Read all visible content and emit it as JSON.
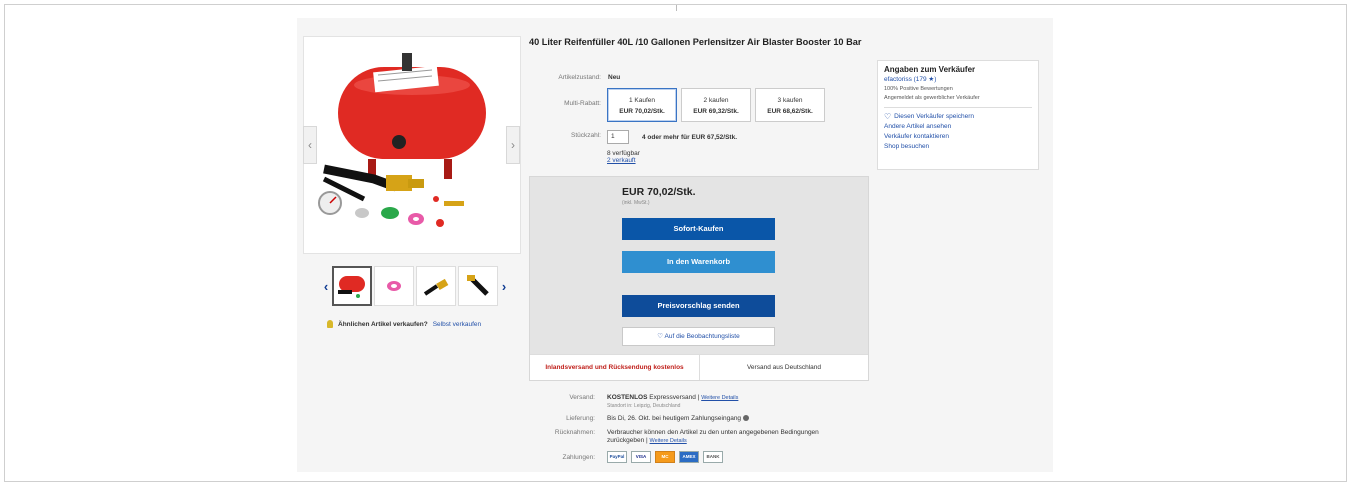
{
  "product": {
    "title": "40 Liter Reifenfüller 40L /10 Gallonen Perlensitzer Air Blaster Booster 10 Bar"
  },
  "gallery": {
    "prev_arrow": "‹",
    "next_arrow": "›",
    "thumb_prev": "‹",
    "thumb_next": "›"
  },
  "sell_similar": {
    "question": "Ähnlichen Artikel verkaufen?",
    "link": "Selbst verkaufen"
  },
  "details": {
    "condition_label": "Artikelzustand:",
    "condition_value": "Neu",
    "multibuy_label": "Multi-Rabatt:",
    "multibuy_options": [
      {
        "qty": "1 Kaufen",
        "price": "EUR 70,02/Stk."
      },
      {
        "qty": "2 kaufen",
        "price": "EUR 69,32/Stk."
      },
      {
        "qty": "3 kaufen",
        "price": "EUR 68,62/Stk."
      }
    ],
    "quantity_label": "Stückzahl:",
    "quantity_value": "1",
    "quantity_offer": "4 oder mehr für EUR 67,52/Stk.",
    "available": "8 verfügbar",
    "sold": "2 verkauft"
  },
  "buybox": {
    "price": "EUR 70,02/Stk.",
    "price_note": "(inkl. MwSt.)",
    "buy_now": "Sofort-Kaufen",
    "add_to_cart": "In den Warenkorb",
    "make_offer": "Preisvorschlag senden",
    "watchlist": "♡ Auf die Beobachtungsliste",
    "free_shipping_returns": "Inlandsversand und Rücksendung kostenlos",
    "ships_from": "Versand aus Deutschland"
  },
  "shipping": {
    "shipping_label": "Versand:",
    "shipping_value_bold": "KOSTENLOS",
    "shipping_value": "Expressversand |",
    "shipping_link": "Weitere Details",
    "shipping_location": "Standort in: Leipzig, Deutschland",
    "delivery_label": "Lieferung:",
    "delivery_value": "Bis Di, 26. Okt. bei heutigem Zahlungseingang",
    "returns_label": "Rücknahmen:",
    "returns_value_line1": "Verbraucher können den Artikel zu den unten angegebenen Bedingungen",
    "returns_value_line2": "zurückgeben |",
    "returns_link": "Weitere Details",
    "payments_label": "Zahlungen:",
    "payment_methods": [
      "PayPal",
      "VISA",
      "MC",
      "AMEX",
      "BANK"
    ]
  },
  "seller": {
    "heading": "Angaben zum Verkäufer",
    "name": "efactoriss (179 ★)",
    "positive": "100% Positive Bewertungen",
    "registered": "Angemeldet als gewerblicher Verkäufer",
    "save_seller": "Diesen Verkäufer speichern",
    "other_items": "Andere Artikel ansehen",
    "contact": "Verkäufer kontaktieren",
    "shop": "Shop besuchen"
  },
  "colors": {
    "accent_blue": "#0a56a8",
    "cart_blue": "#2f8fd0",
    "offer_blue": "#0e4c9a",
    "link_blue": "#2250a8",
    "alert_red": "#c0201b",
    "tank_red": "#e02a23"
  },
  "icons": [
    "chevron-left-icon",
    "chevron-right-icon",
    "lightbulb-icon",
    "heart-icon",
    "info-icon",
    "paypal-icon",
    "visa-icon",
    "mastercard-icon",
    "amex-icon",
    "bank-transfer-icon"
  ]
}
